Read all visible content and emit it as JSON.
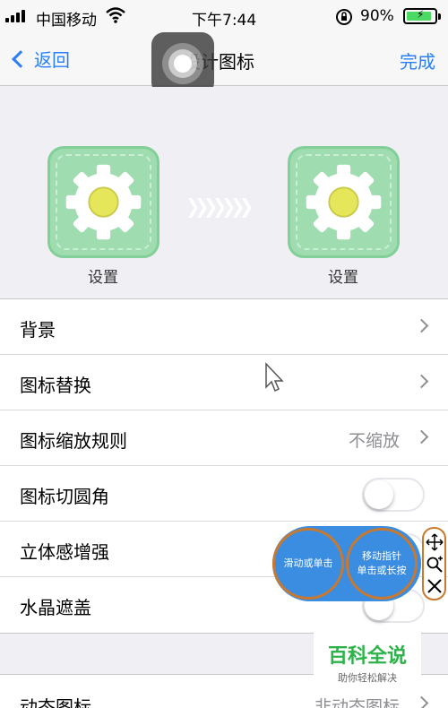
{
  "status_bar": {
    "carrier": "中国移动",
    "time": "下午7:44",
    "battery_percent": "90%",
    "battery_level": 0.9,
    "battery_color": "#4cd964"
  },
  "nav": {
    "back_label": "返回",
    "title": "设计图标",
    "done_label": "完成",
    "accent_color": "#2a7ff6"
  },
  "preview": {
    "before_label": "设置",
    "after_label": "设置"
  },
  "settings": [
    {
      "label": "背景",
      "type": "chevron"
    },
    {
      "label": "图标替换",
      "type": "chevron"
    },
    {
      "label": "图标缩放规则",
      "value": "不缩放",
      "type": "chevron"
    },
    {
      "label": "图标切圆角",
      "type": "toggle",
      "on": false
    },
    {
      "label": "立体感增强",
      "type": "toggle",
      "on": false
    },
    {
      "label": "水晶遮盖",
      "type": "toggle",
      "on": false
    }
  ],
  "settings2": [
    {
      "label": "动态图标",
      "value": "非动态图标",
      "type": "chevron"
    }
  ],
  "overlay": {
    "left_bubble": "滑动或单击",
    "right_bubble_line1": "移动指针",
    "right_bubble_line2": "单击或长按",
    "tools": [
      "move-icon",
      "zoom-in-icon",
      "close-icon"
    ]
  },
  "watermark": {
    "title": "百科全说",
    "subtitle": "助你轻松解决"
  }
}
